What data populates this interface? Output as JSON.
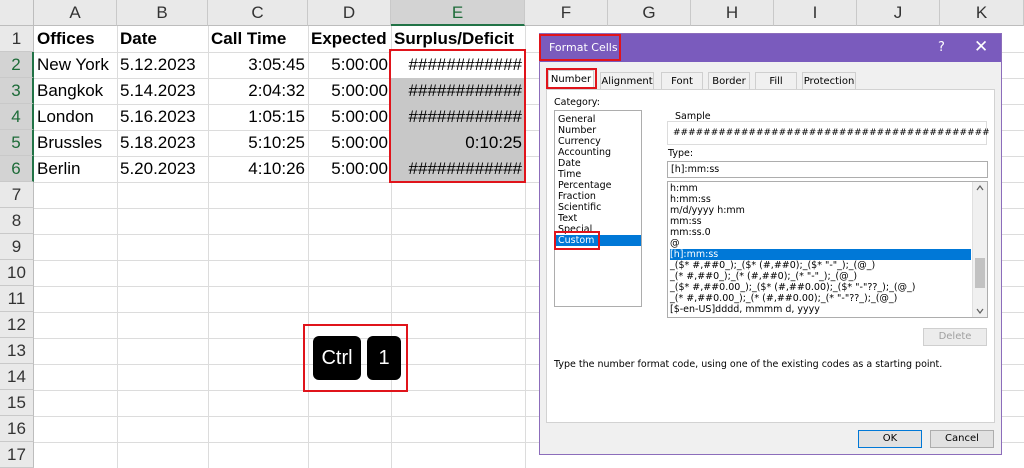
{
  "columns": [
    "A",
    "B",
    "C",
    "D",
    "E",
    "F",
    "G",
    "H",
    "I",
    "J",
    "K"
  ],
  "rows": [
    "1",
    "2",
    "3",
    "4",
    "5",
    "6",
    "7",
    "8",
    "9",
    "10",
    "11",
    "12",
    "13",
    "14",
    "15",
    "16",
    "17"
  ],
  "headers": {
    "offices": "Offices",
    "date": "Date",
    "call_time": "Call Time",
    "expected": "Expected",
    "surplus": "Surplus/Deficit"
  },
  "data_rows": [
    {
      "office": "New York",
      "date": "5.12.2023",
      "call": "3:05:45",
      "expected": "5:00:00",
      "surplus": "############"
    },
    {
      "office": "Bangkok",
      "date": "5.14.2023",
      "call": "2:04:32",
      "expected": "5:00:00",
      "surplus": "############"
    },
    {
      "office": "London",
      "date": "5.16.2023",
      "call": "1:05:15",
      "expected": "5:00:00",
      "surplus": "############"
    },
    {
      "office": "Brussles",
      "date": "5.18.2023",
      "call": "5:10:25",
      "expected": "5:00:00",
      "surplus": "0:10:25"
    },
    {
      "office": "Berlin",
      "date": "5.20.2023",
      "call": "4:10:26",
      "expected": "5:00:00",
      "surplus": "############"
    }
  ],
  "keys": {
    "ctrl": "Ctrl",
    "one": "1"
  },
  "dialog": {
    "title": "Format Cells",
    "help": "?",
    "close": "✕",
    "tabs": [
      "Number",
      "Alignment",
      "Font",
      "Border",
      "Fill",
      "Protection"
    ],
    "category_label": "Category:",
    "categories": [
      "General",
      "Number",
      "Currency",
      "Accounting",
      "Date",
      "Time",
      "Percentage",
      "Fraction",
      "Scientific",
      "Text",
      "Special",
      "Custom"
    ],
    "selected_category": "Custom",
    "sample_label": "Sample",
    "sample_value": "##########################################",
    "type_label": "Type:",
    "type_value": "[h]:mm:ss",
    "type_list": [
      "h:mm",
      "h:mm:ss",
      "m/d/yyyy h:mm",
      "mm:ss",
      "mm:ss.0",
      "@",
      "[h]:mm:ss",
      "_($* #,##0_);_($* (#,##0);_($* \"-\"_);_(@_)",
      "_(* #,##0_);_(* (#,##0);_(* \"-\"_);_(@_)",
      "_($* #,##0.00_);_($* (#,##0.00);_($* \"-\"??_);_(@_)",
      "_(* #,##0.00_);_(* (#,##0.00);_(* \"-\"??_);_(@_)",
      "[$-en-US]dddd, mmmm d, yyyy"
    ],
    "selected_type": "[h]:mm:ss",
    "delete_label": "Delete",
    "hint": "Type the number format code, using one of the existing codes as a starting point.",
    "ok_label": "OK",
    "cancel_label": "Cancel",
    "accent": "#7a5bbd"
  }
}
